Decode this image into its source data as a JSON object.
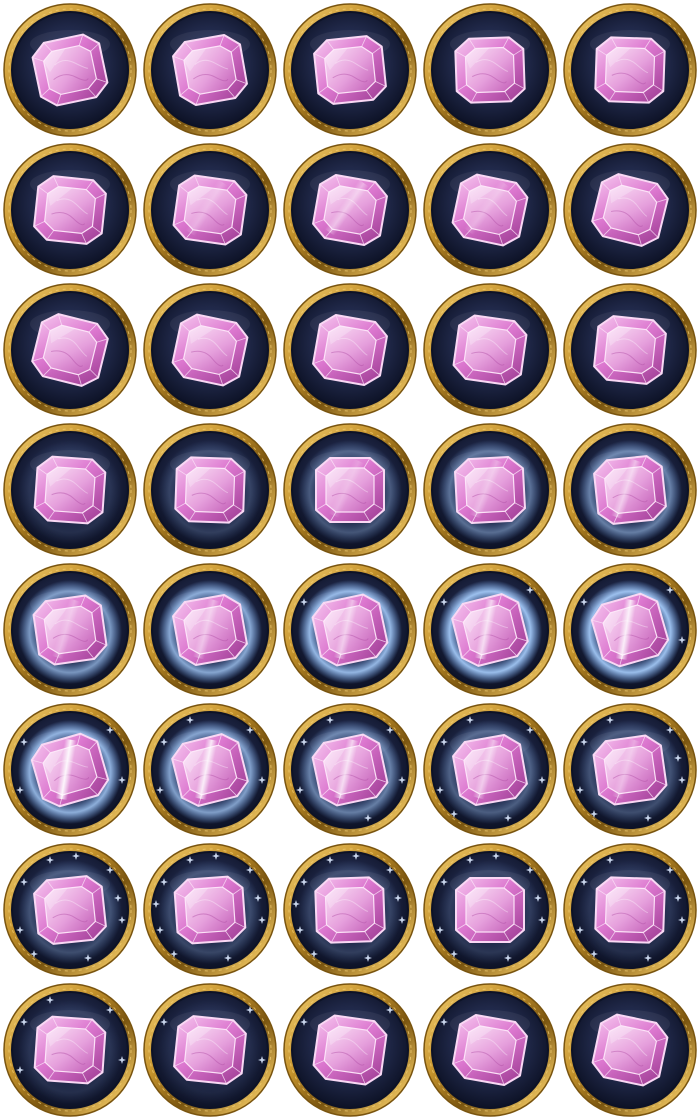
{
  "sprite_sheet": {
    "columns": 5,
    "rows": 8,
    "frame_count": 40,
    "subject": "pink-gem-icon",
    "frame_style": "round-gold-rim-navy-badge",
    "colors": {
      "background": "#ffffff",
      "gold_rim": "#c9962e",
      "gold_dark": "#7a5510",
      "gold_light": "#f3d277",
      "badge_inner": "#1f2747",
      "badge_edge": "#0d1226",
      "gem_light": "#f6c6ef",
      "gem_mid": "#dc77cf",
      "gem_dark": "#9c3a92",
      "glow": "#7fb6ff",
      "sparkle": "#dce9ff"
    },
    "frames": [
      {
        "tilt": -12,
        "glow": 0,
        "sparkle": 0,
        "shine": 0
      },
      {
        "tilt": -10,
        "glow": 0,
        "sparkle": 0,
        "shine": 0
      },
      {
        "tilt": -6,
        "glow": 0,
        "sparkle": 0,
        "shine": 0
      },
      {
        "tilt": -2,
        "glow": 0,
        "sparkle": 0,
        "shine": 0
      },
      {
        "tilt": 2,
        "glow": 0,
        "sparkle": 0,
        "shine": 0
      },
      {
        "tilt": 6,
        "glow": 0,
        "sparkle": 0,
        "shine": 0
      },
      {
        "tilt": 8,
        "glow": 0,
        "sparkle": 0,
        "shine": 0.2
      },
      {
        "tilt": 10,
        "glow": 0,
        "sparkle": 0,
        "shine": 0.4
      },
      {
        "tilt": 12,
        "glow": 0,
        "sparkle": 0,
        "shine": 0.2
      },
      {
        "tilt": 14,
        "glow": 0,
        "sparkle": 0,
        "shine": 0
      },
      {
        "tilt": 14,
        "glow": 0,
        "sparkle": 0,
        "shine": 0
      },
      {
        "tilt": 12,
        "glow": 0,
        "sparkle": 0,
        "shine": 0
      },
      {
        "tilt": 10,
        "glow": 0,
        "sparkle": 0,
        "shine": 0
      },
      {
        "tilt": 8,
        "glow": 0,
        "sparkle": 0,
        "shine": 0
      },
      {
        "tilt": 6,
        "glow": 0,
        "sparkle": 0,
        "shine": 0
      },
      {
        "tilt": 4,
        "glow": 0.1,
        "sparkle": 0,
        "shine": 0
      },
      {
        "tilt": 2,
        "glow": 0.2,
        "sparkle": 0,
        "shine": 0
      },
      {
        "tilt": 0,
        "glow": 0.35,
        "sparkle": 0,
        "shine": 0.2
      },
      {
        "tilt": -3,
        "glow": 0.5,
        "sparkle": 0,
        "shine": 0.3
      },
      {
        "tilt": -6,
        "glow": 0.6,
        "sparkle": 0,
        "shine": 0.5
      },
      {
        "tilt": -8,
        "glow": 0.75,
        "sparkle": 0,
        "shine": 0.3
      },
      {
        "tilt": -10,
        "glow": 0.85,
        "sparkle": 0,
        "shine": 0.4
      },
      {
        "tilt": -12,
        "glow": 0.95,
        "sparkle": 0.1,
        "shine": 0.5
      },
      {
        "tilt": -14,
        "glow": 1,
        "sparkle": 0.2,
        "shine": 0.7
      },
      {
        "tilt": -16,
        "glow": 1,
        "sparkle": 0.3,
        "shine": 0.9
      },
      {
        "tilt": -16,
        "glow": 0.9,
        "sparkle": 0.4,
        "shine": 1
      },
      {
        "tilt": -14,
        "glow": 0.8,
        "sparkle": 0.5,
        "shine": 0.9
      },
      {
        "tilt": -12,
        "glow": 0.6,
        "sparkle": 0.6,
        "shine": 0.7
      },
      {
        "tilt": -10,
        "glow": 0.4,
        "sparkle": 0.7,
        "shine": 0.5
      },
      {
        "tilt": -8,
        "glow": 0.3,
        "sparkle": 0.8,
        "shine": 0.3
      },
      {
        "tilt": -6,
        "glow": 0.3,
        "sparkle": 0.9,
        "shine": 0
      },
      {
        "tilt": -4,
        "glow": 0.25,
        "sparkle": 1,
        "shine": 0
      },
      {
        "tilt": -2,
        "glow": 0.2,
        "sparkle": 1,
        "shine": 0
      },
      {
        "tilt": 0,
        "glow": 0.15,
        "sparkle": 0.9,
        "shine": 0
      },
      {
        "tilt": 2,
        "glow": 0.1,
        "sparkle": 0.8,
        "shine": 0
      },
      {
        "tilt": 4,
        "glow": 0.1,
        "sparkle": 0.5,
        "shine": 0
      },
      {
        "tilt": 6,
        "glow": 0.05,
        "sparkle": 0.3,
        "shine": 0
      },
      {
        "tilt": 8,
        "glow": 0,
        "sparkle": 0.2,
        "shine": 0
      },
      {
        "tilt": 10,
        "glow": 0,
        "sparkle": 0.1,
        "shine": 0
      },
      {
        "tilt": 12,
        "glow": 0,
        "sparkle": 0,
        "shine": 0
      }
    ]
  }
}
